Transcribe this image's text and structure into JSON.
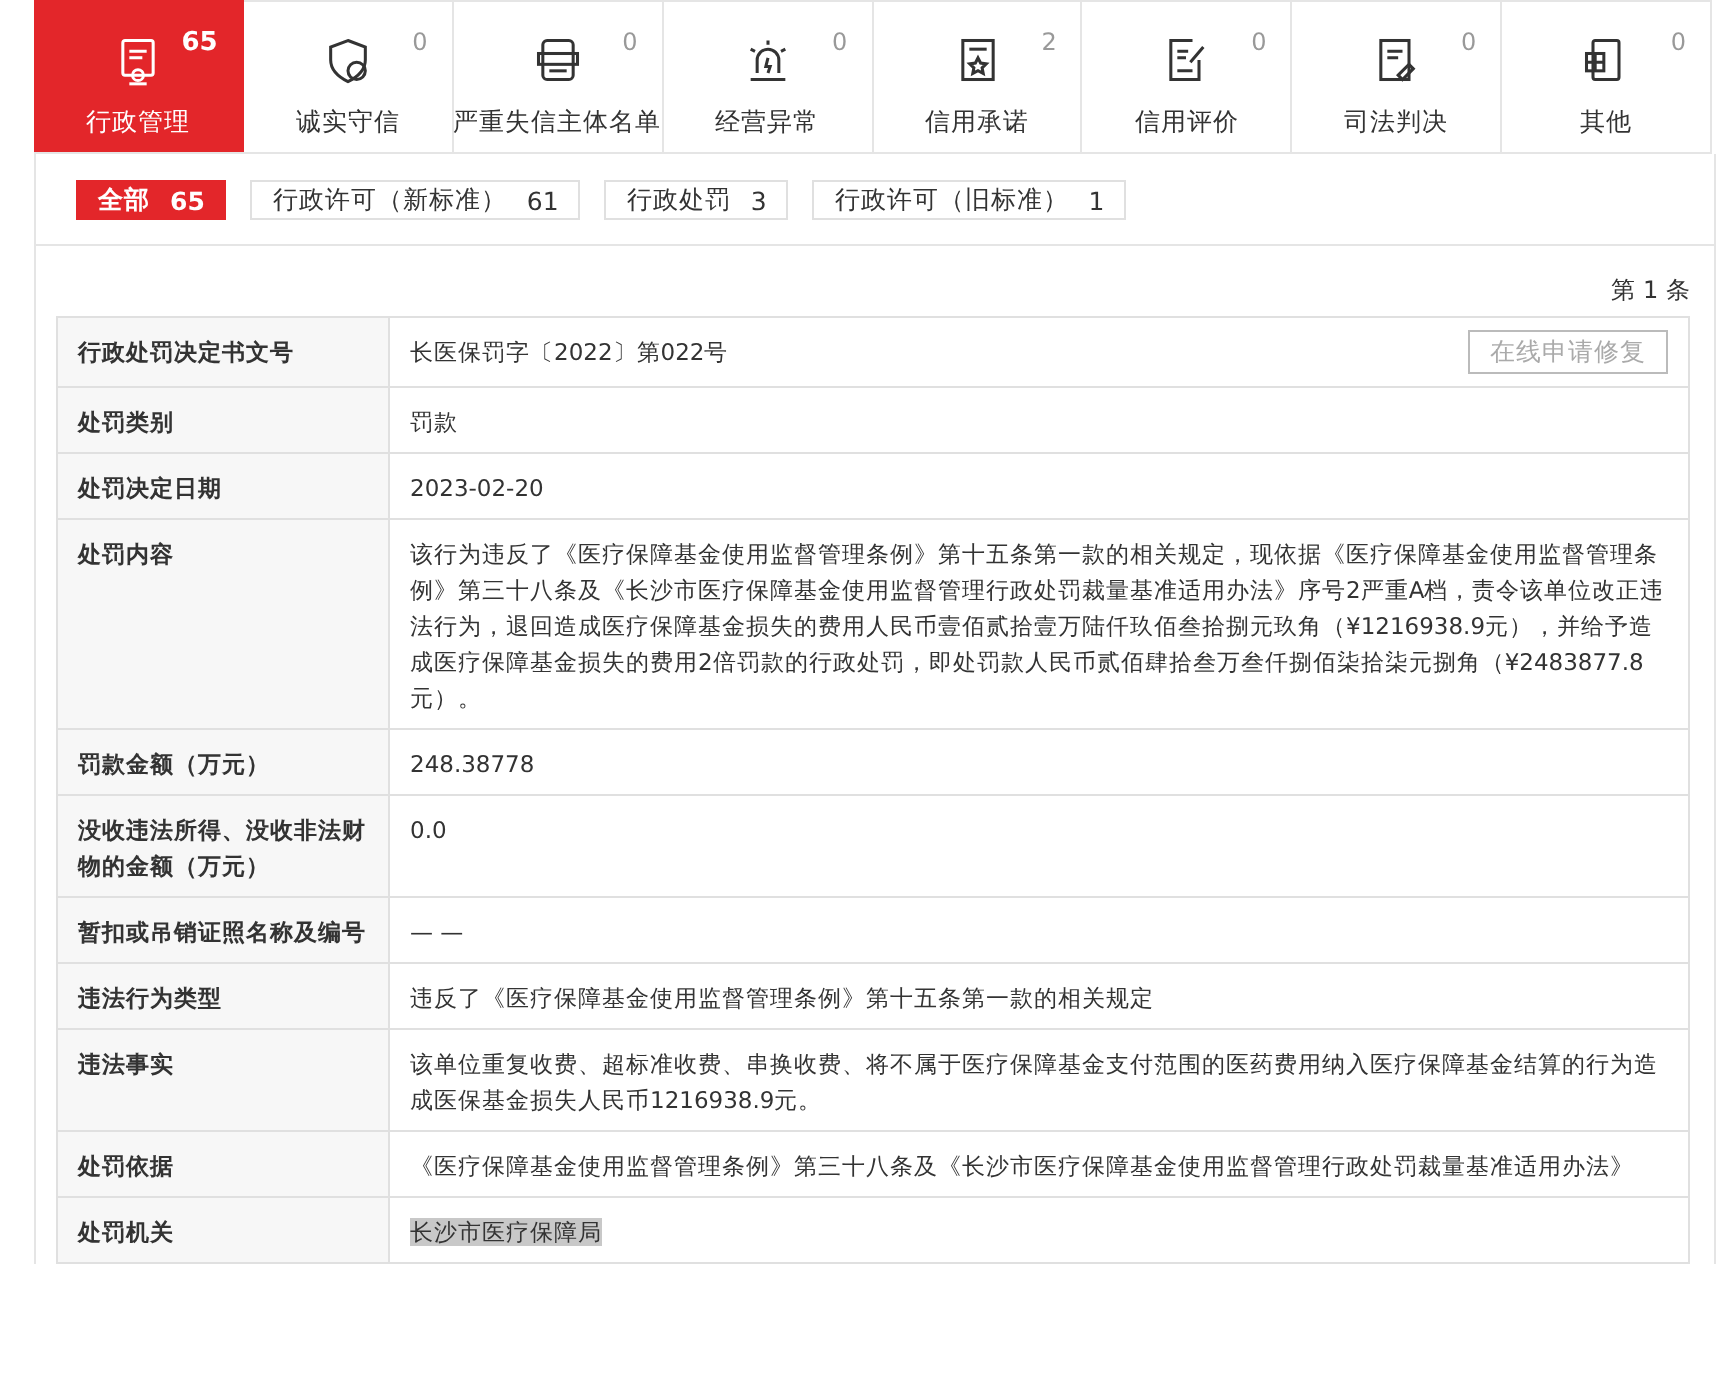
{
  "tabs": [
    {
      "label": "行政管理",
      "count": "65",
      "kind": "admin",
      "selected": true
    },
    {
      "label": "诚实守信",
      "count": "0",
      "kind": "honesty",
      "selected": false
    },
    {
      "label": "严重失信主体名单",
      "count": "0",
      "kind": "blacklist",
      "selected": false
    },
    {
      "label": "经营异常",
      "count": "0",
      "kind": "alarm",
      "selected": false
    },
    {
      "label": "信用承诺",
      "count": "2",
      "kind": "promise",
      "selected": false
    },
    {
      "label": "信用评价",
      "count": "0",
      "kind": "rating",
      "selected": false
    },
    {
      "label": "司法判决",
      "count": "0",
      "kind": "judicial",
      "selected": false
    },
    {
      "label": "其他",
      "count": "0",
      "kind": "other",
      "selected": false
    }
  ],
  "filters": [
    {
      "label": "全部",
      "count": "65",
      "selected": true
    },
    {
      "label": "行政许可（新标准）",
      "count": "61",
      "selected": false
    },
    {
      "label": "行政处罚",
      "count": "3",
      "selected": false
    },
    {
      "label": "行政许可（旧标准）",
      "count": "1",
      "selected": false
    }
  ],
  "record_index": "第 1 条",
  "fields": [
    {
      "label": "行政处罚决定书文号",
      "value": "长医保罚字〔2022〕第022号",
      "button": "在线申请修复",
      "highlighted": false
    },
    {
      "label": "处罚类别",
      "value": "罚款",
      "highlighted": false
    },
    {
      "label": "处罚决定日期",
      "value": "2023-02-20",
      "highlighted": false
    },
    {
      "label": "处罚内容",
      "value": "该行为违反了《医疗保障基金使用监督管理条例》第十五条第一款的相关规定，现依据《医疗保障基金使用监督管理条例》第三十八条及《长沙市医疗保障基金使用监督管理行政处罚裁量基准适用办法》序号2严重A档，责令该单位改正违法行为，退回造成医疗保障基金损失的费用人民币壹佰贰拾壹万陆仟玖佰叁拾捌元玖角（¥1216938.9元），并给予造成医疗保障基金损失的费用2倍罚款的行政处罚，即处罚款人民币贰佰肆拾叁万叁仟捌佰柒拾柒元捌角（¥2483877.8元）。",
      "highlighted": false
    },
    {
      "label": "罚款金额（万元）",
      "value": "248.38778",
      "highlighted": false
    },
    {
      "label": "没收违法所得、没收非法财物的金额（万元）",
      "value": "0.0",
      "highlighted": false
    },
    {
      "label": "暂扣或吊销证照名称及编号",
      "value": "— —",
      "highlighted": false
    },
    {
      "label": "违法行为类型",
      "value": "违反了《医疗保障基金使用监督管理条例》第十五条第一款的相关规定",
      "highlighted": false
    },
    {
      "label": "违法事实",
      "value": "该单位重复收费、超标准收费、串换收费、将不属于医疗保障基金支付范围的医药费用纳入医疗保障基金结算的行为造成医保基金损失人民币1216938.9元。",
      "highlighted": false
    },
    {
      "label": "处罚依据",
      "value": "《医疗保障基金使用监督管理条例》第三十八条及《长沙市医疗保障基金使用监督管理行政处罚裁量基准适用办法》",
      "highlighted": false
    },
    {
      "label": "处罚机关",
      "value": "长沙市医疗保障局",
      "highlighted": true
    }
  ]
}
